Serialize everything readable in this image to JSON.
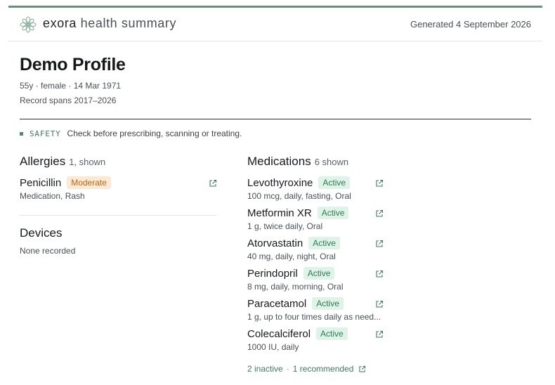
{
  "header": {
    "brand_part1": "exora",
    "brand_part2": "health summary",
    "generated": "Generated 4 September 2026"
  },
  "profile": {
    "name": "Demo Profile",
    "meta": "55y · female · 14 Mar 1971",
    "record_span": "Record spans 2017–2026"
  },
  "safety": {
    "tag": "SAFETY",
    "text": "Check before prescribing, scanning or treating."
  },
  "allergies": {
    "title": "Allergies",
    "count": "1, shown",
    "items": [
      {
        "name": "Penicillin",
        "badge": "Moderate",
        "detail": "Medication, Rash"
      }
    ]
  },
  "devices": {
    "title": "Devices",
    "empty": "None recorded"
  },
  "medications": {
    "title": "Medications",
    "count": "6 shown",
    "items": [
      {
        "name": "Levothyroxine",
        "badge": "Active",
        "detail": "100 mcg, daily, fasting, Oral"
      },
      {
        "name": "Metformin XR",
        "badge": "Active",
        "detail": "1 g, twice daily, Oral"
      },
      {
        "name": "Atorvastatin",
        "badge": "Active",
        "detail": "40 mg, daily, night, Oral"
      },
      {
        "name": "Perindopril",
        "badge": "Active",
        "detail": "8 mg, daily, morning, Oral"
      },
      {
        "name": "Paracetamol",
        "badge": "Active",
        "detail": "1 g, up to four times daily as need..."
      },
      {
        "name": "Colecalciferol",
        "badge": "Active",
        "detail": "1000 IU, daily"
      }
    ],
    "footer": {
      "inactive": "2 inactive",
      "separator": "·",
      "recommended": "1 recommended"
    }
  },
  "colors": {
    "accent": "#6b8f7b",
    "active_bg": "#dff3e8",
    "active_fg": "#2f7a55",
    "moderate_bg": "#fde9d3",
    "moderate_fg": "#b8691a"
  },
  "icons": [
    "flower-logo-icon",
    "external-link-icon"
  ]
}
